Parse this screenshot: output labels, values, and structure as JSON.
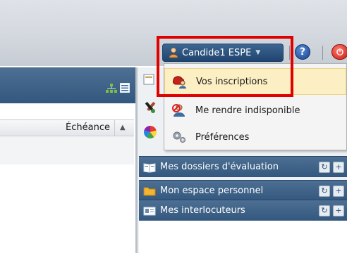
{
  "header": {
    "user_button_label": "Candide1 ESPE",
    "help_label": "?",
    "power_label": "⏻"
  },
  "left_panel": {
    "columns": [
      {
        "label": "Échéance",
        "sort": "ascending"
      }
    ]
  },
  "user_menu": {
    "items": [
      {
        "label": "Vos inscriptions",
        "icon": "inscriptions-icon",
        "highlighted": true
      },
      {
        "label": "Me rendre indisponible",
        "icon": "unavailable-user-icon"
      },
      {
        "label": "Préférences",
        "icon": "gears-icon"
      }
    ]
  },
  "accordion": {
    "items": [
      {
        "label": "Mes dossiers d'évaluation",
        "icon": "book-icon"
      },
      {
        "label": "Mon espace personnel",
        "icon": "folder-icon"
      },
      {
        "label": "Mes interlocuteurs",
        "icon": "contacts-icon"
      }
    ],
    "refresh_glyph": "↻",
    "add_glyph": "+"
  },
  "colors": {
    "header_band": "#d3d8de",
    "panel_header": "#3f628a",
    "menu_hover": "#fcefc3",
    "highlight": "#e00000"
  }
}
